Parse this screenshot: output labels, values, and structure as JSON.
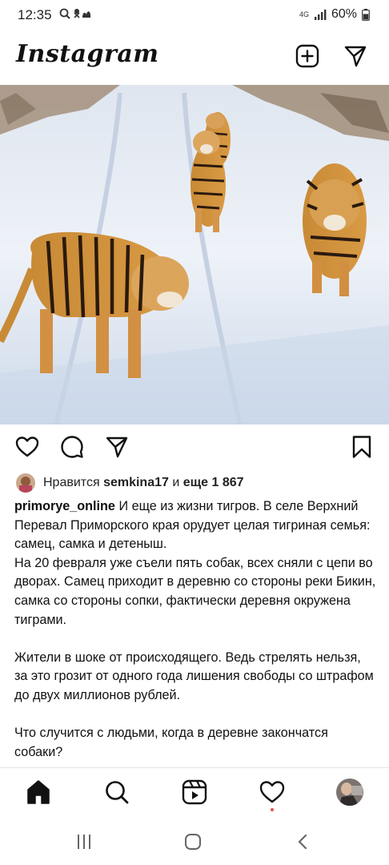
{
  "status_bar": {
    "time": "12:35",
    "network": "4G",
    "battery": "60%",
    "icons": [
      "search-icon",
      "notification-icon",
      "signal-icon",
      "battery-icon"
    ]
  },
  "header": {
    "app_name": "Instagram",
    "icons": [
      "new-post-icon",
      "direct-message-icon"
    ]
  },
  "post": {
    "image_icon": "tigers-on-snowy-road-photo",
    "actions": [
      "heart-icon",
      "comment-icon",
      "share-icon",
      "bookmark-icon"
    ],
    "likes": {
      "prefix": "Нравится",
      "user": "semkina17",
      "middle": "и",
      "others": "еще 1 867"
    },
    "caption": {
      "username": "primorye_online",
      "first_line": "И еще из жизни тигров. В селе Верхний Перевал Приморского края орудует целая тигриная семья: самец, самка и детеныш.",
      "paragraph1": "На 20 февраля уже съели пять собак, всех сняли с цепи во дворах. Самец приходит в деревню со стороны реки Бикин, самка со стороны сопки, фактически деревня окружена тиграми.",
      "paragraph2": "Жители в шоке от происходящего. Ведь стрелять нельзя, за это грозит от одного года лишения свободы со штрафом до двух миллионов рублей.",
      "paragraph3": "Что случится с людьми, когда в деревне закончатся собаки?"
    }
  },
  "bottom_nav": {
    "items": [
      "home-icon",
      "search-icon",
      "reels-icon",
      "activity-icon",
      "profile-avatar"
    ],
    "notification_color": "#ed4956"
  },
  "system_nav": [
    "recents-icon",
    "home-circle-icon",
    "back-icon"
  ]
}
